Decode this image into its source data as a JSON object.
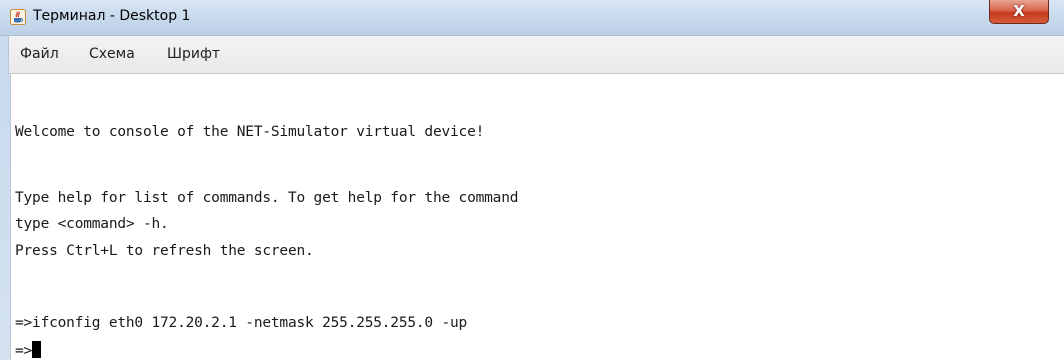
{
  "window": {
    "title": "Терминал - Desktop 1"
  },
  "titlebar": {
    "app_icon": "java-cup-icon",
    "close_icon": "close-icon",
    "close_glyph": "X",
    "close_color": "#c5391d"
  },
  "menubar": {
    "items": [
      {
        "label": "Файл"
      },
      {
        "label": "Схема"
      },
      {
        "label": "Шрифт"
      }
    ]
  },
  "console": {
    "lines": [
      "Welcome to console of the NET-Simulator virtual device!",
      "",
      "Type help for list of commands. To get help for the command",
      "type <command> -h.",
      "Press Ctrl+L to refresh the screen.",
      "",
      "=>ifconfig eth0 172.20.2.1 -netmask 255.255.255.0 -up"
    ],
    "prompt": "=>"
  }
}
